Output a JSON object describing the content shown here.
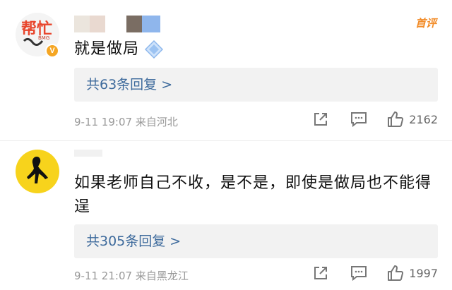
{
  "comments": [
    {
      "avatar_text": "帮忙",
      "avatar_sub": "BMG",
      "verified_badge": "V",
      "text": "就是做局",
      "first_badge": "首评",
      "replies_label": "共63条回复 >",
      "time": "9-11 19:07",
      "location": "来自河北",
      "likes": "2162"
    },
    {
      "text": "如果老师自己不收，是不是，即使是做局也不能得逞",
      "replies_label": "共305条回复 >",
      "time": "9-11 21:07",
      "location": "来自黑龙江",
      "likes": "1997"
    }
  ],
  "colors": {
    "link": "#3d6a9c",
    "first_badge": "#f28c28",
    "verified": "#f5a623",
    "avatar2_bg": "#f7d31c"
  },
  "icons": [
    "share-icon",
    "comment-icon",
    "like-icon",
    "diamond-emoji-icon"
  ]
}
